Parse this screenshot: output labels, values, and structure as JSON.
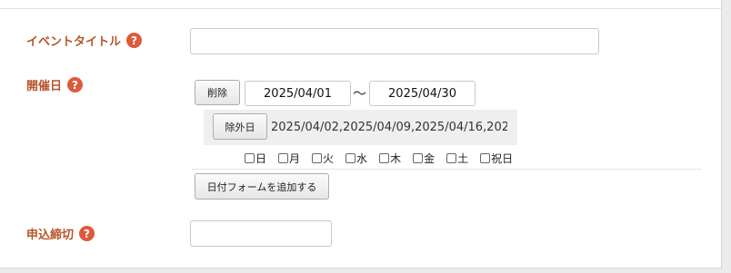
{
  "event_title": {
    "label": "イベントタイトル",
    "help_glyph": "?",
    "value": ""
  },
  "event_date": {
    "label": "開催日",
    "help_glyph": "?",
    "delete_label": "削除",
    "start_date": "2025/04/01",
    "separator": "〜",
    "end_date": "2025/04/30",
    "exclude_label": "除外日",
    "excluded_dates": "2025/04/02,2025/04/09,2025/04/16,202...",
    "weekdays": [
      {
        "label": "日",
        "checked": false
      },
      {
        "label": "月",
        "checked": false
      },
      {
        "label": "火",
        "checked": false
      },
      {
        "label": "水",
        "checked": false
      },
      {
        "label": "木",
        "checked": false
      },
      {
        "label": "金",
        "checked": false
      },
      {
        "label": "土",
        "checked": false
      },
      {
        "label": "祝日",
        "checked": false
      }
    ],
    "add_form_label": "日付フォームを追加する"
  },
  "deadline": {
    "label": "申込締切",
    "help_glyph": "?",
    "value": ""
  },
  "colors": {
    "label": "#b5552b",
    "help_badge": "#dc5b3c"
  }
}
